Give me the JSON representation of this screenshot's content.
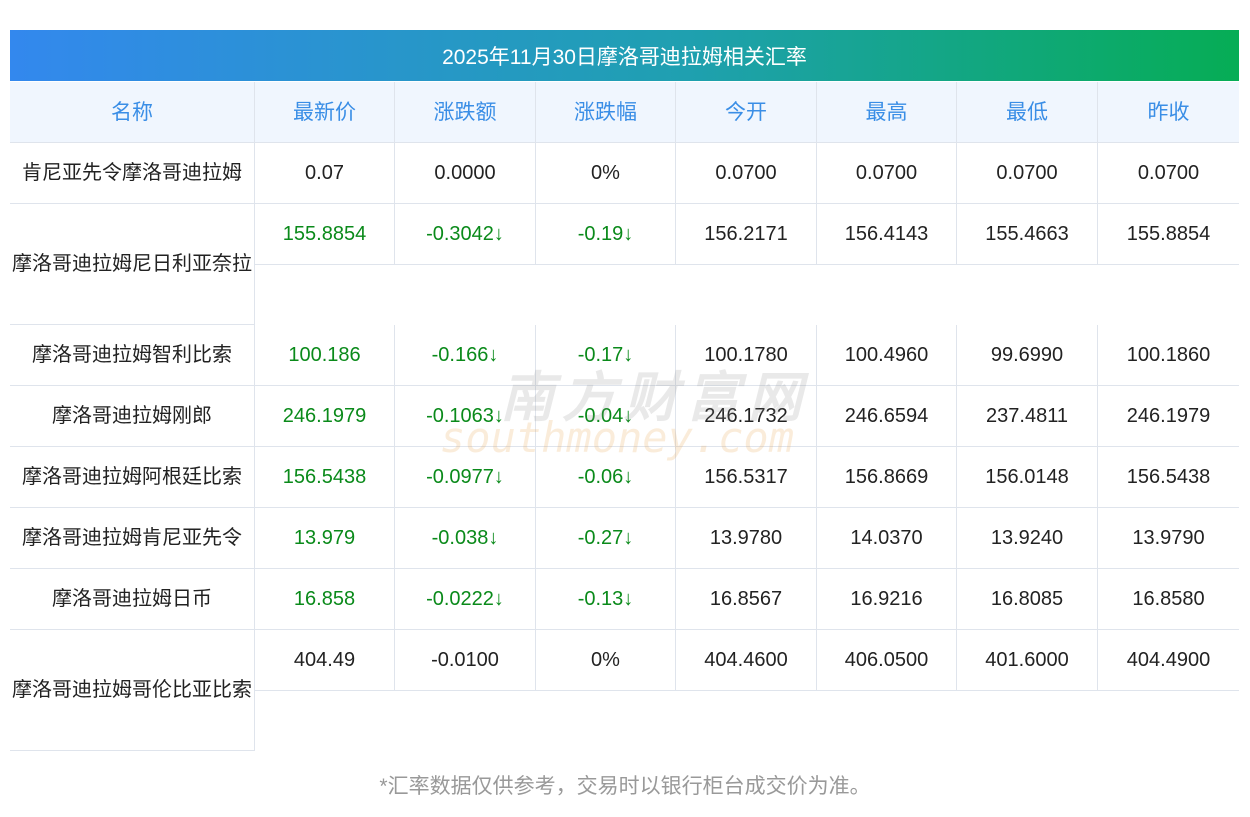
{
  "title": "2025年11月30日摩洛哥迪拉姆相关汇率",
  "headers": [
    "名称",
    "最新价",
    "涨跌额",
    "涨跌幅",
    "今开",
    "最高",
    "最低",
    "昨收"
  ],
  "rows": [
    {
      "name": "肯尼亚先令摩洛哥迪拉姆",
      "values": [
        "0.07",
        "0.0000",
        "0%",
        "0.0700",
        "0.0700",
        "0.0700",
        "0.0700"
      ],
      "down": false
    },
    {
      "name": "摩洛哥迪拉姆尼日利亚奈拉",
      "values": [
        "155.8854",
        "-0.3042↓",
        "-0.19↓",
        "156.2171",
        "156.4143",
        "155.4663",
        "155.8854"
      ],
      "down": true
    },
    {
      "name": "摩洛哥迪拉姆智利比索",
      "values": [
        "100.186",
        "-0.166↓",
        "-0.17↓",
        "100.1780",
        "100.4960",
        "99.6990",
        "100.1860"
      ],
      "down": true
    },
    {
      "name": "摩洛哥迪拉姆刚郎",
      "values": [
        "246.1979",
        "-0.1063↓",
        "-0.04↓",
        "246.1732",
        "246.6594",
        "237.4811",
        "246.1979"
      ],
      "down": true
    },
    {
      "name": "摩洛哥迪拉姆阿根廷比索",
      "values": [
        "156.5438",
        "-0.0977↓",
        "-0.06↓",
        "156.5317",
        "156.8669",
        "156.0148",
        "156.5438"
      ],
      "down": true
    },
    {
      "name": "摩洛哥迪拉姆肯尼亚先令",
      "values": [
        "13.979",
        "-0.038↓",
        "-0.27↓",
        "13.9780",
        "14.0370",
        "13.9240",
        "13.9790"
      ],
      "down": true
    },
    {
      "name": "摩洛哥迪拉姆日币",
      "values": [
        "16.858",
        "-0.0222↓",
        "-0.13↓",
        "16.8567",
        "16.9216",
        "16.8085",
        "16.8580"
      ],
      "down": true
    },
    {
      "name": "摩洛哥迪拉姆哥伦比亚比索",
      "values": [
        "404.49",
        "-0.0100",
        "0%",
        "404.4600",
        "406.0500",
        "401.6000",
        "404.4900"
      ],
      "down": false
    }
  ],
  "watermark": {
    "cn": "南方财富网",
    "en": "southmoney.com"
  },
  "note": "*汇率数据仅供参考，交易时以银行柜台成交价为准。",
  "colors": {
    "down": "#0a8a1a",
    "header": "#3a8ee6"
  }
}
